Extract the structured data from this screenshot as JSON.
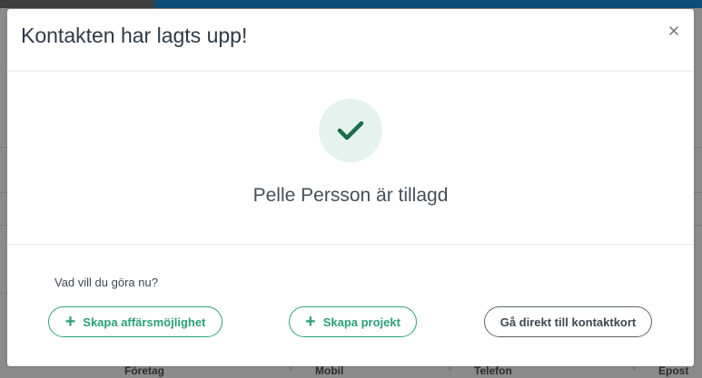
{
  "background": {
    "columns": [
      {
        "label": "Företag"
      },
      {
        "label": "Mobil"
      },
      {
        "label": "Telefon"
      },
      {
        "label": "Epost"
      }
    ]
  },
  "modal": {
    "title": "Kontakten har lagts upp!",
    "close_icon": "close-icon",
    "success_icon": "checkmark-icon",
    "added_message": "Pelle Persson är tillagd",
    "question": "Vad vill du göra nu?",
    "actions": [
      {
        "label": "Skapa affärsmöjlighet",
        "icon": "plus-icon"
      },
      {
        "label": "Skapa projekt",
        "icon": "plus-icon"
      },
      {
        "label": "Gå direkt till kontaktkort"
      }
    ]
  },
  "colors": {
    "accent_green": "#2aa175",
    "check_bg": "#e5f3ee",
    "check_dark": "#1e6b4e"
  }
}
